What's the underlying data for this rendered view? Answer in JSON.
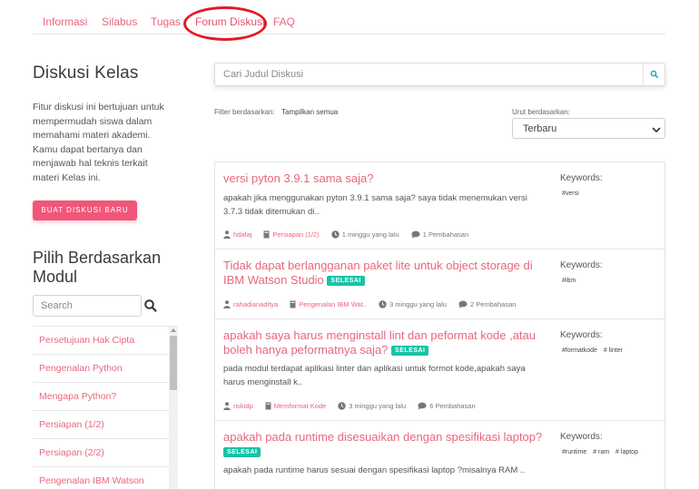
{
  "tabs": [
    {
      "label": "Informasi"
    },
    {
      "label": "Silabus"
    },
    {
      "label": "Tugas"
    },
    {
      "label": "Forum Diskusi"
    },
    {
      "label": "FAQ"
    }
  ],
  "sidebar": {
    "title": "Diskusi Kelas",
    "description": "Fitur diskusi ini bertujuan untuk mempermudah siswa dalam memahami materi akademi. Kamu dapat bertanya dan menjawab hal teknis terkait materi Kelas ini.",
    "new_button": "BUAT DISKUSI BARU",
    "module_title": "Pilih Berdasarkan Modul",
    "module_search_placeholder": "Search",
    "modules": [
      "Persetujuan Hak Cipta",
      "Pengenalan Python",
      "Mengapa Python?",
      "Persiapan (1/2)",
      "Persiapan (2/2)",
      "Pengenalan IBM Watson"
    ]
  },
  "search": {
    "placeholder": "Cari Judul Diskusi"
  },
  "filter": {
    "label": "Filter berdasarkan:",
    "value": "Tampilkan semua"
  },
  "sort": {
    "label": "Urut berdasarkan:",
    "value": "Terbaru"
  },
  "keywords_label": "Keywords:",
  "badge_label": "SELESAI",
  "discussions": [
    {
      "title": "versi pyton 3.9.1 sama saja?",
      "solved": false,
      "body": "apakah jika menggunakan pyton 3.9.1 sama saja? saya tidak menemukan versi 3.7.3 tidak ditemukan di..",
      "author": "hdafaj",
      "module": "Persiapan (1/2)",
      "time": "1 minggu yang lalu",
      "replies": "1 Pembahasan",
      "keywords": [
        "#versi"
      ]
    },
    {
      "title": "Tidak dapat berlangganan paket lite untuk object storage di IBM Watson Studio",
      "solved": true,
      "body": "",
      "author": "rahadianaditya",
      "module": "Pengenalan IBM Wat..",
      "time": "3 minggu yang lalu",
      "replies": "2 Pembahasan",
      "keywords": [
        "#ibm"
      ]
    },
    {
      "title": "apakah saya harus menginstall lint dan peformat kode ,atau boleh hanya peformatnya saja?",
      "solved": true,
      "body": "pada modul terdapat aplikasi linter dan aplikasi untuk formot kode,apakah saya harus menginstall k..",
      "author": "riskidp",
      "module": "Memformat Kode",
      "time": "3 minggu yang lalu",
      "replies": "6 Pembahasan",
      "keywords": [
        "#formatkode",
        "# linter"
      ]
    },
    {
      "title": "apakah pada runtime disesuaikan dengan spesifikasi laptop?",
      "solved": true,
      "body": "apakah pada runtime harus sesuai dengan spesifikasi laptop ?misalnya RAM ..",
      "author": "",
      "module": "",
      "time": "",
      "replies": "",
      "keywords": [
        "#runtime",
        "# ram",
        "# laptop"
      ]
    }
  ],
  "colors": {
    "accent": "#e8677e",
    "button": "#f0567a",
    "badge": "#17c3a6",
    "highlight_circle": "#e01b24"
  },
  "icons": [
    "search-icon",
    "user-icon",
    "book-icon",
    "clock-icon",
    "comment-icon",
    "chevron-down-icon"
  ]
}
